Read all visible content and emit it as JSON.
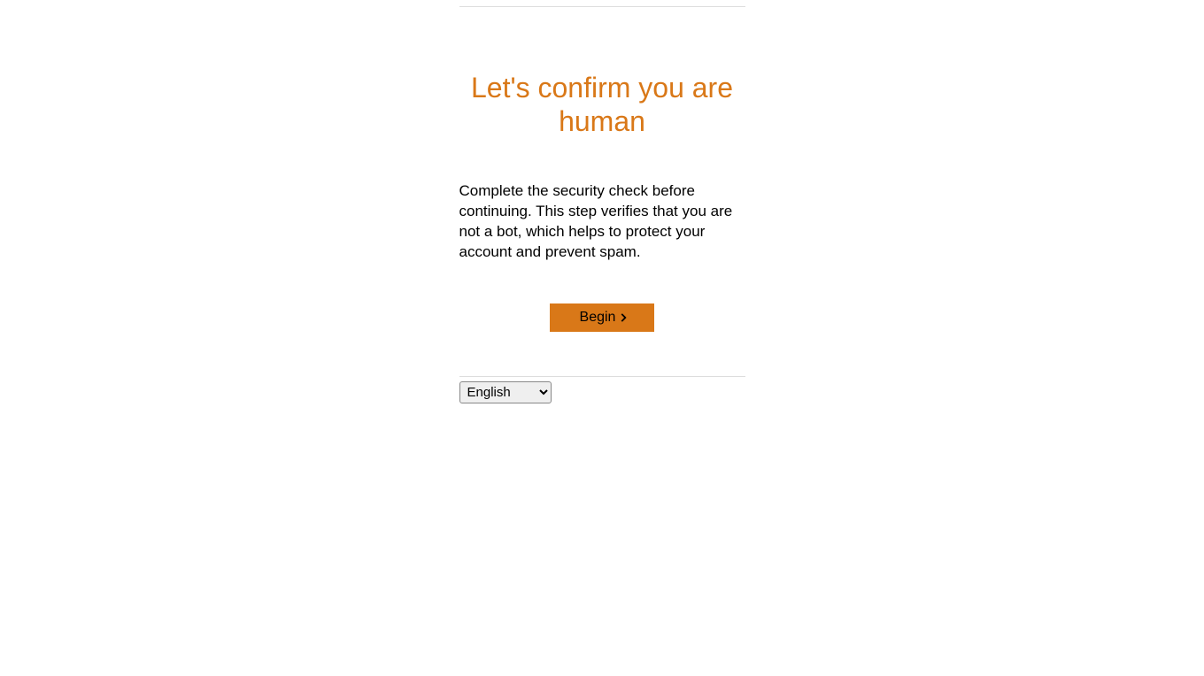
{
  "heading": "Let's confirm you are human",
  "description": "Complete the security check before continuing. This step verifies that you are not a bot, which helps to protect your account and prevent spam.",
  "begin_button_label": "Begin",
  "language": {
    "selected": "English",
    "options": [
      "English"
    ]
  }
}
